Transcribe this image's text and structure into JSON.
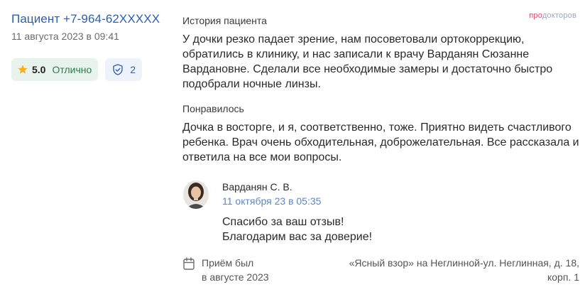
{
  "review": {
    "author": "Пациент +7-964-62XXXXX",
    "date": "11 августа 2023 в 09:41",
    "rating_value": "5.0",
    "rating_text": "Отлично",
    "verified_count": "2",
    "history_title": "История пациента",
    "history_text": "У дочки резко падает зрение, нам посоветовали ортокоррекцию, обратились в клинику, и нас записали к врачу Варданян Сюзанне Вардановне. Сделали все необходимые замеры и достаточно быстро подобрали ночные линзы.",
    "liked_title": "Понравилось",
    "liked_text": "Дочка в восторге, и я, соответственно, тоже. Приятно видеть счастливого ребенка. Врач очень обходительная, доброжелательная. Все рассказала и ответила на все мои вопросы."
  },
  "brand": {
    "part1": "про",
    "part2": "докторов"
  },
  "reply": {
    "doctor": "Варданян С. В.",
    "date": "11 октября 23 в 05:35",
    "line1": "Спасибо за ваш отзыв!",
    "line2": "Благодарим вас за доверие!"
  },
  "footer": {
    "visit_line1": "Приём был",
    "visit_line2": "в августе 2023",
    "clinic_line1": "«Ясный взор» на Неглинной-ул. Неглинная, д. 18,",
    "clinic_line2": "корп. 1"
  },
  "icons": {
    "rating": "star-icon",
    "verify": "shield-check-icon",
    "calendar": "calendar-icon"
  },
  "colors": {
    "accent": "#2f5fa8",
    "star": "#f4b324",
    "rating_bg": "#e7f3ec",
    "verify_bg": "#eef3fb",
    "brand_pink": "#e14b6c"
  }
}
